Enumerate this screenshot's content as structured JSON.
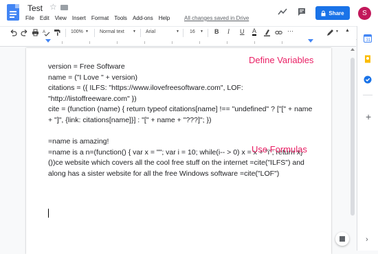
{
  "app": {
    "title": "Test",
    "saved_status": "All changes saved in Drive",
    "share_label": "Share",
    "avatar_letter": "S",
    "brand_color": "#1a73e8",
    "accent_pink": "#e91e63"
  },
  "menu": [
    "File",
    "Edit",
    "View",
    "Insert",
    "Format",
    "Tools",
    "Add-ons",
    "Help"
  ],
  "toolbar": {
    "zoom": "100%",
    "style": "Normal text",
    "font": "Arial",
    "size": "16",
    "bold": "B",
    "italic": "I",
    "underline": "U",
    "text_color": "A"
  },
  "document": {
    "heading_variables": "Define Variables",
    "heading_formulas": "Use Formulas",
    "code_lines": [
      "version = Free Software",
      "name = (\"I Love \" + version)",
      "citations = ({ ILFS: \"https://www.ilovefreesoftware.com\", LOF: \"http://listoffreeware.com\" })",
      "cite = (function (name) { return typeof citations[name] !== \"undefined\" ? [\"[\" + name + \"]\", {link: citations[name]}] : \"[\" + name + \"???]\"; })"
    ],
    "formula_lines": [
      "=name is amazing!",
      "=name is a n=(function() { var x = \"\"; var i = 10; while(i-- > 0) x = x + \"i\"; return x} ())ce website which covers all the cool free stuff on the internet =cite(\"ILFS\") and along has a sister website for all the free Windows software =cite(\"LOF\")"
    ]
  },
  "icons": {
    "docs": "docs-logo-icon",
    "star": "star-icon",
    "folder": "folder-icon",
    "activity": "trending-icon",
    "comments": "comment-icon",
    "lock": "lock-icon",
    "calendar": "calendar-icon",
    "keep": "keep-icon",
    "tasks": "tasks-icon",
    "add": "plus-icon",
    "explore": "explore-icon"
  }
}
